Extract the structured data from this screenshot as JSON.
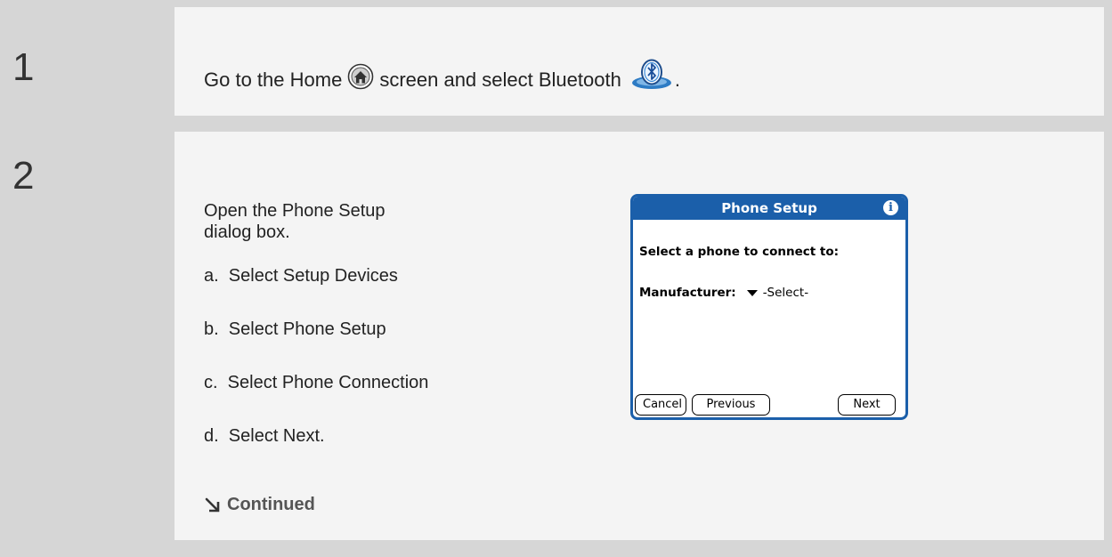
{
  "steps": [
    {
      "number": "1",
      "text_before_home": "Go to the Home",
      "text_after_home": "screen and select Bluetooth",
      "text_end": "."
    },
    {
      "number": "2",
      "intro": "Open the Phone Setup dialog box.",
      "substeps": [
        "a.  Select Setup Devices",
        "b.  Select Phone Setup",
        "c.  Select Phone Connection",
        "d.  Select Next."
      ],
      "continued": "Continued"
    }
  ],
  "dialog": {
    "title": "Phone Setup",
    "info_glyph": "i",
    "prompt": "Select a phone to connect to:",
    "manufacturer_label": "Manufacturer:",
    "manufacturer_value": "-Select-",
    "buttons": {
      "cancel": "Cancel",
      "previous": "Previous",
      "next": "Next"
    },
    "accent_color": "#1b5faa"
  },
  "icons": {
    "home": "home-icon",
    "bluetooth": "bluetooth-icon",
    "continued_arrow": "arrow-down-right-icon",
    "info": "info-icon",
    "dropdown": "triangle-down-icon"
  }
}
